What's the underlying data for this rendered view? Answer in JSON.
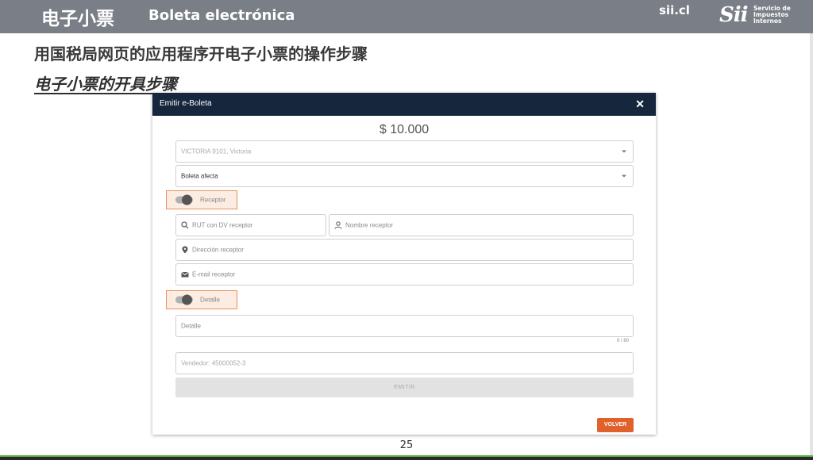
{
  "header": {
    "title_zh": "电子小票",
    "title_es": "Boleta electrónica",
    "site": "sii.cl",
    "logo_mark": "Sii",
    "logo_text": "Servicio de Impuestos Internos"
  },
  "slide": {
    "title": "用国税局网页的应用程序开电子小票的操作步骤",
    "subtitle": "电子小票的开具步骤",
    "page_number": "25"
  },
  "modal": {
    "title": "Emitir e-Boleta",
    "close": "✕",
    "amount": "$ 10.000",
    "address_select": "VICTORIA 9101, Victoria",
    "type_select": "Boleta afecta",
    "receptor_toggle": "Receptor",
    "rut_placeholder": "RUT con DV receptor",
    "name_placeholder": "Nombre receptor",
    "address_placeholder": "Dirección receptor",
    "email_placeholder": "E-mail receptor",
    "detalle_toggle": "Detalle",
    "detalle_placeholder": "Detalle",
    "detalle_counter": "0 / 80",
    "vendedor": "Vendedor: 45000052-3",
    "emitir_button": "EMITIR",
    "volver_button": "VOLVER"
  },
  "colors": {
    "header_bg": "#7a7e86",
    "modal_header": "#15263d",
    "highlight_border": "#e8915a",
    "volver": "#e0612b"
  }
}
